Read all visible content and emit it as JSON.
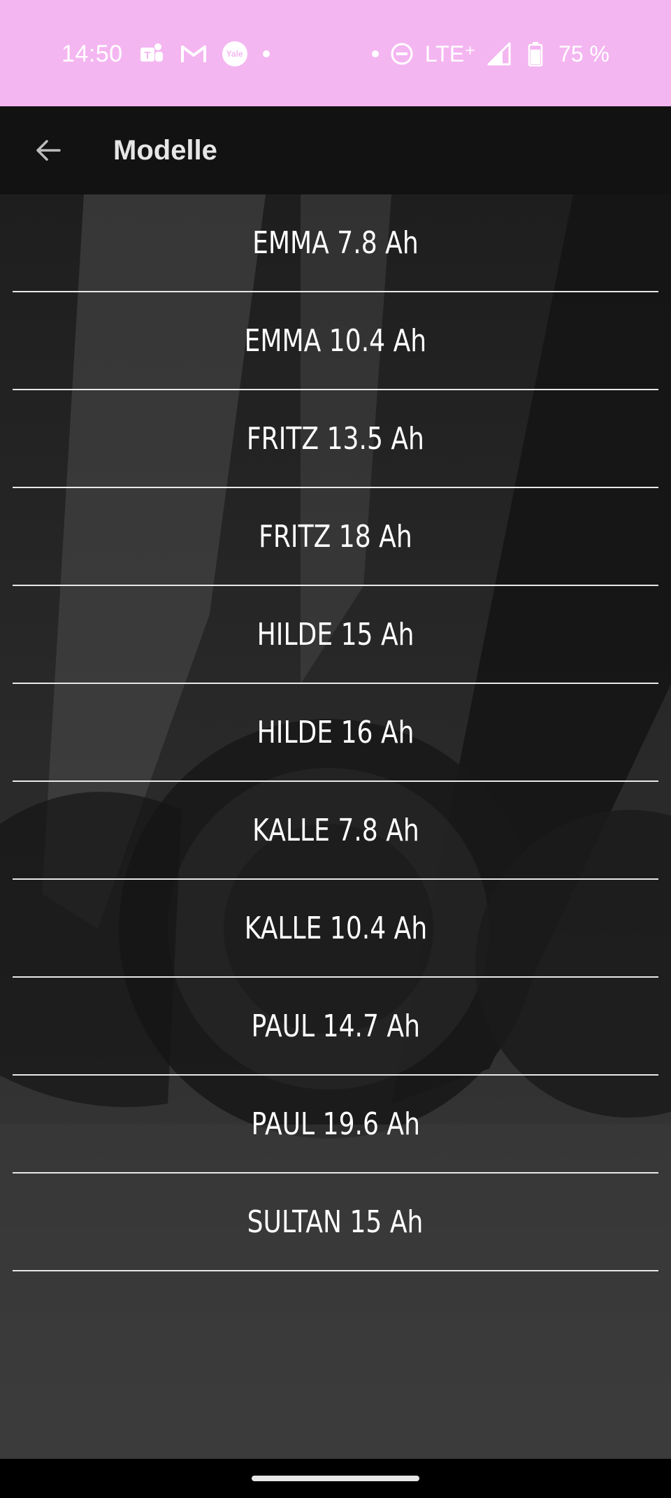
{
  "status_bar": {
    "time": "14:50",
    "left_icons": [
      "teams-icon",
      "gmail-icon",
      "yale-icon"
    ],
    "yale_label": "Yale",
    "network": "LTE⁺",
    "battery": "75 %",
    "background_color": "#f4b6f1"
  },
  "app_bar": {
    "title": "Modelle",
    "back_icon": "arrow-back-icon"
  },
  "models": [
    "EMMA 7.8 Ah",
    "EMMA 10.4 Ah",
    "FRITZ 13.5 Ah",
    "FRITZ 18 Ah",
    "HILDE 15 Ah",
    "HILDE 16 Ah",
    "KALLE 7.8 Ah",
    "KALLE 10.4 Ah",
    "PAUL 14.7 Ah",
    "PAUL 19.6 Ah",
    "SULTAN 15 Ah"
  ]
}
